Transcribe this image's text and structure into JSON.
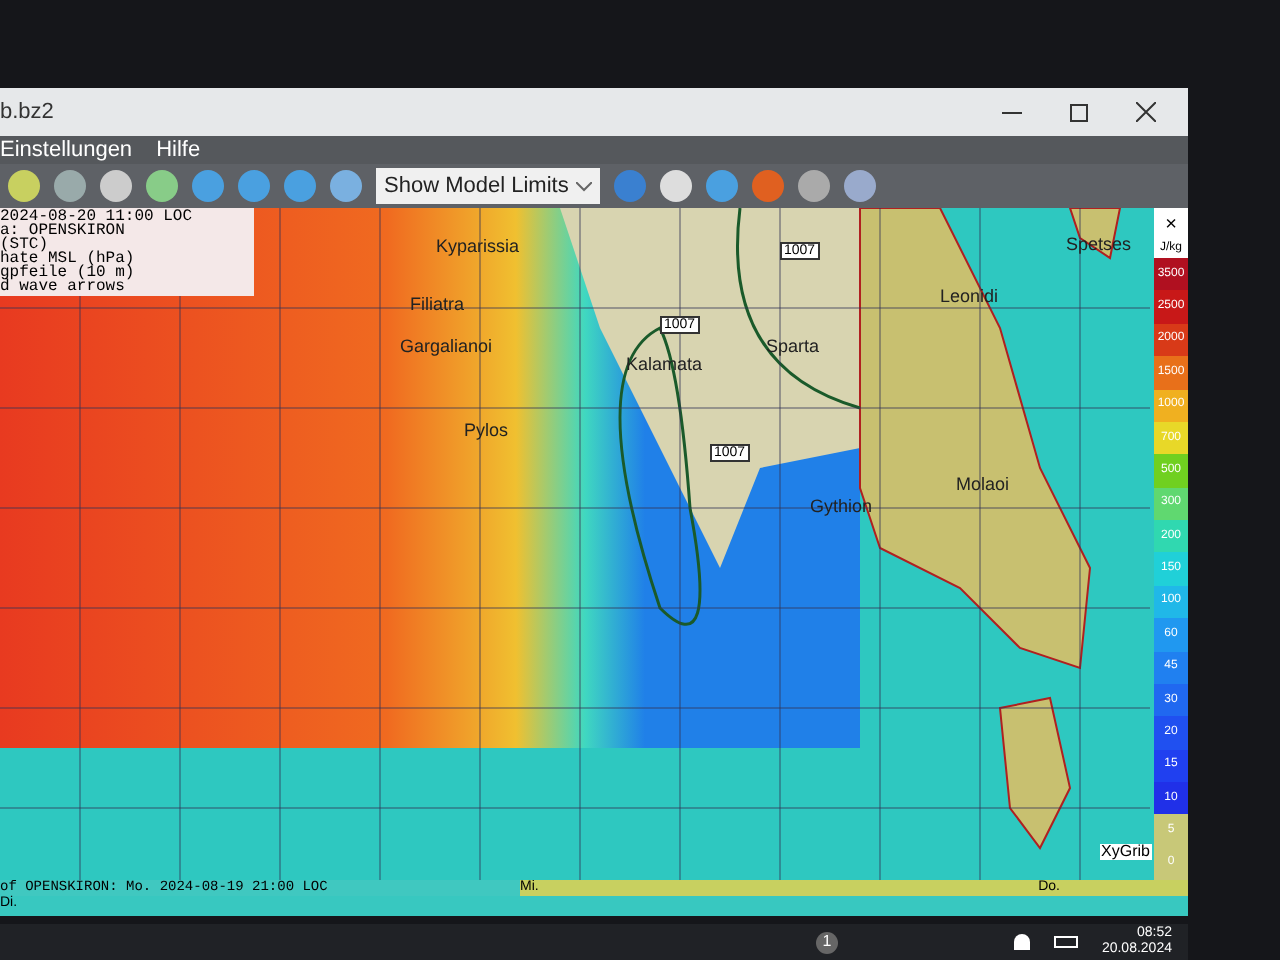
{
  "window": {
    "title": "b.bz2"
  },
  "menu": [
    "Einstellungen",
    "Hilfe"
  ],
  "toolbar": {
    "dropdown": "Show Model Limits"
  },
  "info_lines": [
    "2024-08-20 11:00 LOC",
    "a: OPENSKIRON",
    "(STC)",
    "hate MSL (hPa)",
    "gpfeile (10 m)",
    "d wave arrows"
  ],
  "places": [
    {
      "name": "Kyparissia"
    },
    {
      "name": "Filiatra"
    },
    {
      "name": "Gargalianoi"
    },
    {
      "name": "Pylos"
    },
    {
      "name": "Kalamata"
    },
    {
      "name": "Sparta"
    },
    {
      "name": "Gythion"
    },
    {
      "name": "Leonidi"
    },
    {
      "name": "Molaoi"
    },
    {
      "name": "Spetses"
    }
  ],
  "isobar_labels": [
    "1007",
    "1007",
    "1007"
  ],
  "legend": {
    "unit": "J/kg",
    "close": "×",
    "items": [
      {
        "label": "3500",
        "color": "#b01020"
      },
      {
        "label": "2500",
        "color": "#c81818"
      },
      {
        "label": "2000",
        "color": "#d83a18"
      },
      {
        "label": "1500",
        "color": "#e8701a"
      },
      {
        "label": "1000",
        "color": "#f0b020"
      },
      {
        "label": "700",
        "color": "#e8d828"
      },
      {
        "label": "500",
        "color": "#70d020"
      },
      {
        "label": "300",
        "color": "#60d870"
      },
      {
        "label": "200",
        "color": "#30d8b0"
      },
      {
        "label": "150",
        "color": "#20d0d8"
      },
      {
        "label": "100",
        "color": "#20b8e8"
      },
      {
        "label": "60",
        "color": "#2098f0"
      },
      {
        "label": "45",
        "color": "#2080f0"
      },
      {
        "label": "30",
        "color": "#2068f0"
      },
      {
        "label": "20",
        "color": "#2050f0"
      },
      {
        "label": "15",
        "color": "#2040f0"
      },
      {
        "label": "10",
        "color": "#2030e8"
      },
      {
        "label": "5",
        "color": "#c8c878"
      },
      {
        "label": "0",
        "color": "#c8c878"
      }
    ]
  },
  "credit": "XyGrib",
  "timeline": {
    "start": "of OPENSKIRON: Mo. 2024-08-19 21:00 LOC",
    "days": [
      "Di.",
      "Mi.",
      "Do."
    ]
  },
  "taskbar": {
    "badge": "1",
    "time": "08:52",
    "date": "20.08.2024"
  }
}
